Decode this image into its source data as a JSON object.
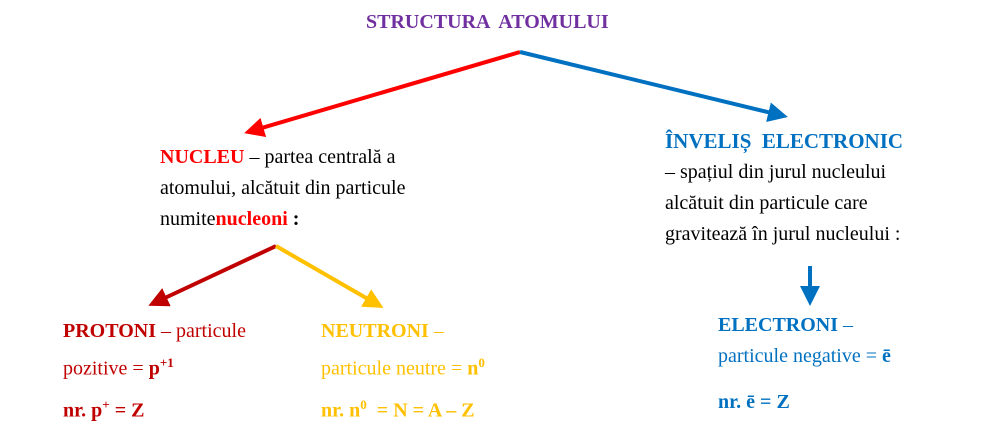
{
  "title": "STRUCTURA  ATOMULUI",
  "nucleu": {
    "term": "NUCLEU",
    "line1_rest": " – partea centrală a",
    "line2": "atomului, alcătuit din particule",
    "line3_prefix": "numite",
    "line3_term": "nucleoni",
    "line3_suffix": " :"
  },
  "invelis": {
    "term": "ÎNVELIȘ  ELECTRONIC",
    "line2": "– spațiul din jurul nucleului",
    "line3": "alcătuit din particule care",
    "line4": "gravitează în jurul nucleului :"
  },
  "protoni": {
    "term": "PROTONI",
    "line1_rest": " – particule",
    "line2_prefix": "pozitive = ",
    "symbol": "p",
    "symbol_sup": "+1",
    "formula_prefix": "nr. p",
    "formula_sup": "+",
    "formula_rest": " = Z"
  },
  "neutroni": {
    "term": "NEUTRONI",
    "line1_rest": " –",
    "line2_prefix": "particule neutre = ",
    "symbol": "n",
    "symbol_sup": "0",
    "formula_prefix": "nr. n",
    "formula_sup": "0",
    "formula_rest": "  = N = A – Z"
  },
  "electroni": {
    "term": "ELECTRONI",
    "line1_rest": " –",
    "line2_prefix": "particule negative = ",
    "symbol": "ē",
    "formula": "nr. ē = Z"
  },
  "colors": {
    "title": "#7030A0",
    "nucleu": "#FF0000",
    "invelis": "#0070C0",
    "protoni": "#C00000",
    "neutroni": "#FFC000",
    "electroni": "#0070C0"
  }
}
